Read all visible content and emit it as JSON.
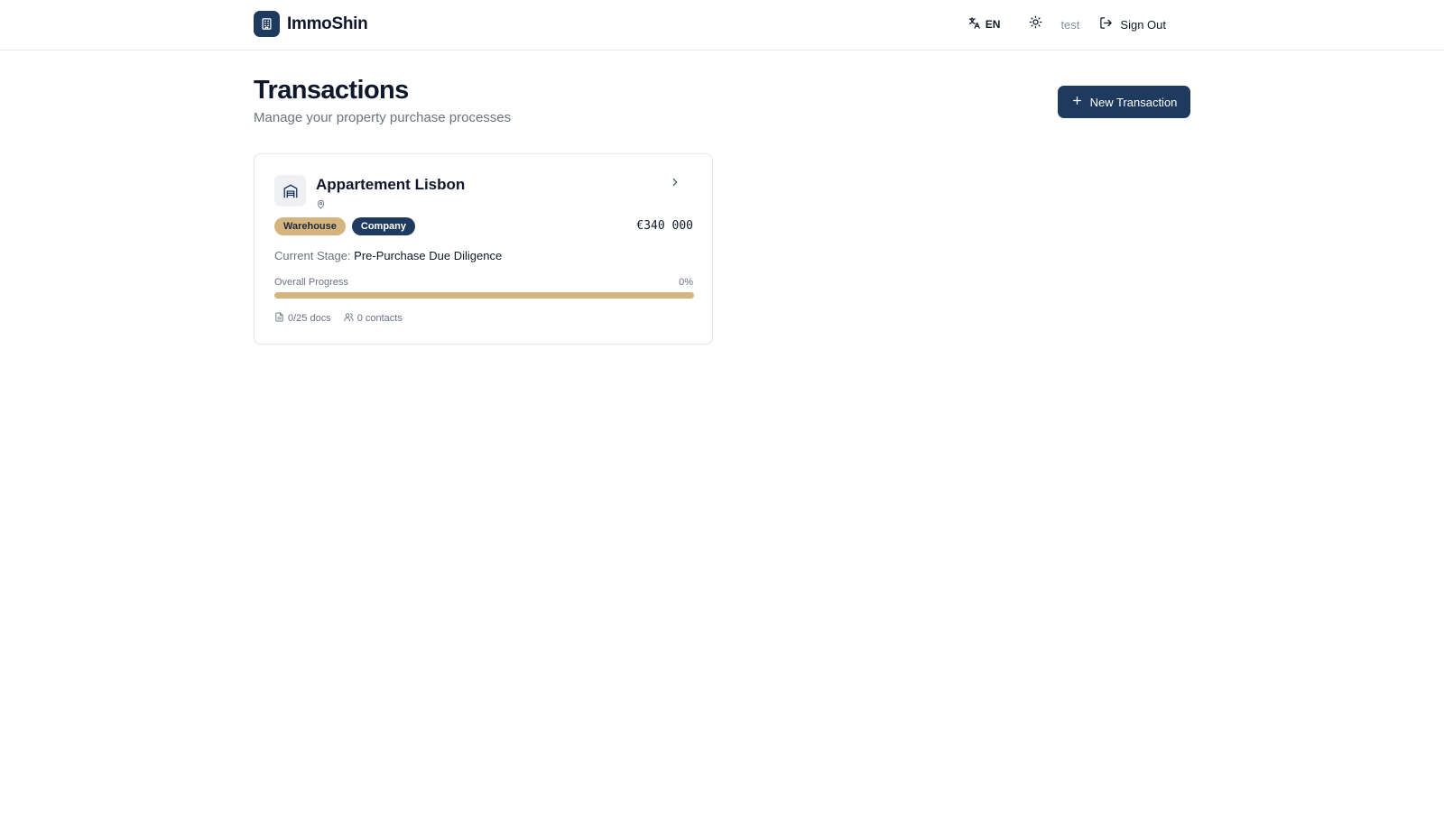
{
  "app": {
    "name": "ImmoShin"
  },
  "header": {
    "language": "EN",
    "user": "test",
    "sign_out": "Sign Out"
  },
  "page": {
    "title": "Transactions",
    "subtitle": "Manage your property purchase processes",
    "new_button": "New Transaction"
  },
  "transactions": [
    {
      "title": "Appartement Lisbon",
      "tags": [
        "Warehouse",
        "Company"
      ],
      "price": "€340 000",
      "stage_label": "Current Stage:",
      "stage_value": "Pre-Purchase Due Diligence",
      "progress_label": "Overall Progress",
      "progress_text": "0%",
      "progress_fraction": 0,
      "docs": "0/25 docs",
      "contacts": "0 contacts"
    }
  ],
  "colors": {
    "primary": "#1e3a5f",
    "accent": "#d4b57f"
  },
  "icons": {
    "logo": "building-icon",
    "language": "translate-icon",
    "theme": "sun-icon",
    "sign_out": "log-out-icon",
    "new": "plus-icon",
    "property": "warehouse-icon",
    "location": "map-pin-icon",
    "open": "chevron-right-icon",
    "docs": "file-icon",
    "contacts": "users-icon"
  }
}
